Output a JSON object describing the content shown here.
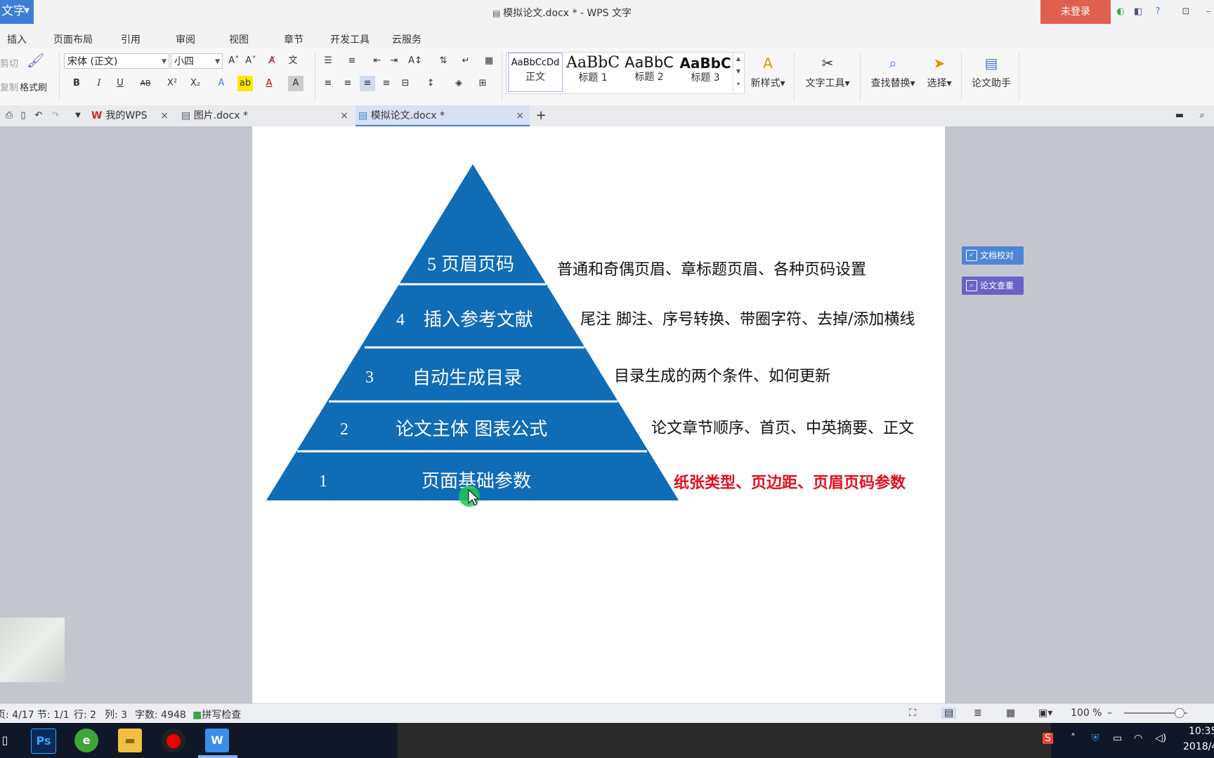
{
  "app": {
    "title": "模拟论文.docx * - WPS 文字",
    "app_button": "文字",
    "login": "未登录"
  },
  "menu": {
    "tabs": [
      "插入",
      "页面布局",
      "引用",
      "审阅",
      "视图",
      "章节",
      "开发工具",
      "云服务"
    ]
  },
  "ribbon": {
    "cut": "剪切",
    "copy": "复制",
    "format_painter": "格式刷",
    "font_name": "宋体 (正文)",
    "font_size": "小四",
    "styles": [
      {
        "sample": "AaBbCcDd",
        "label": "正文"
      },
      {
        "sample": "AaBbC",
        "label": "标题 1"
      },
      {
        "sample": "AaBbC",
        "label": "标题 2"
      },
      {
        "sample": "AaBbC",
        "label": "标题 3"
      }
    ],
    "new_style": "新样式",
    "text_tools": "文字工具",
    "find_replace": "查找替换",
    "select": "选择",
    "paper_assistant": "论文助手"
  },
  "doc_tabs": {
    "wps": "我的WPS",
    "tab1": "图片.docx *",
    "tab2": "模拟论文.docx *"
  },
  "pyramid": {
    "levels": [
      {
        "num": "5",
        "title": "页眉页码",
        "desc": "普通和奇偶页眉、章标题页眉、各种页码设置"
      },
      {
        "num": "4",
        "title": "插入参考文献",
        "desc": "尾注  脚注、序号转换、带圈字符、去掉/添加横线"
      },
      {
        "num": "3",
        "title": "自动生成目录",
        "desc": "目录生成的两个条件、如何更新"
      },
      {
        "num": "2",
        "title": "论文主体  图表公式",
        "desc": "论文章节顺序、首页、中英摘要、正文"
      },
      {
        "num": "1",
        "title": "页面基础参数",
        "desc": "纸张类型、页边距、页眉页码参数"
      }
    ],
    "fill_color": "#0f6cb6",
    "highlight_color": "#e0101e"
  },
  "side_panel": {
    "proofread": "文档校对",
    "plagiarism": "论文查重"
  },
  "status": {
    "page": "页: 4/17",
    "section": "节: 1/1",
    "row": "行: 2",
    "col": "列: 3",
    "word_count": "字数: 4948",
    "spell_check": "拼写检查",
    "zoom": "100 %"
  },
  "taskbar": {
    "time": "10:35",
    "date": "2018/4"
  }
}
